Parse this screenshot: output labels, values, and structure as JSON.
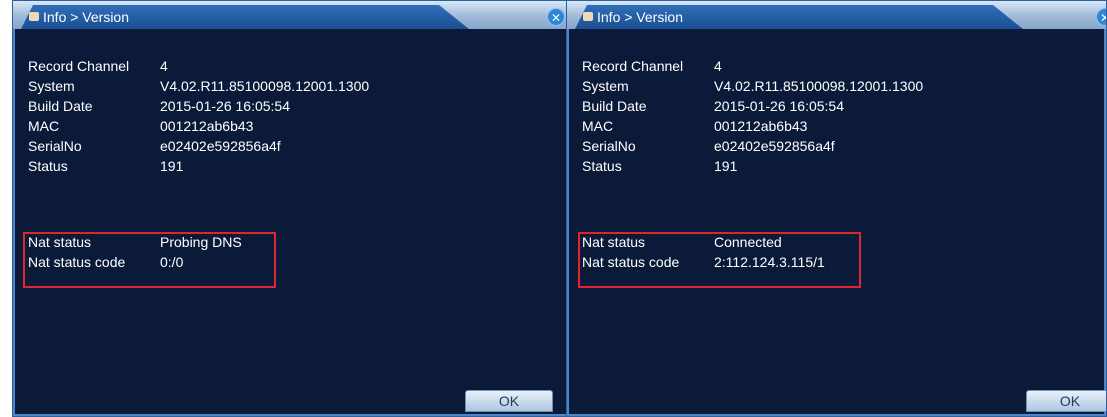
{
  "panels": [
    {
      "breadcrumb": "Info > Version",
      "close_glyph": "✕",
      "rows": [
        {
          "label": "Record Channel",
          "value": "4"
        },
        {
          "label": "System",
          "value": "V4.02.R11.85100098.12001.1300"
        },
        {
          "label": "Build Date",
          "value": "2015-01-26 16:05:54"
        },
        {
          "label": "MAC",
          "value": "001212ab6b43"
        },
        {
          "label": "SerialNo",
          "value": "e02402e592856a4f"
        },
        {
          "label": "Status",
          "value": "191"
        }
      ],
      "nat": [
        {
          "label": "Nat status",
          "value": "Probing DNS"
        },
        {
          "label": "Nat status code",
          "value": "0:/0"
        }
      ],
      "ok_label": "OK"
    },
    {
      "breadcrumb": "Info > Version",
      "close_glyph": "✕",
      "rows": [
        {
          "label": "Record Channel",
          "value": "4"
        },
        {
          "label": "System",
          "value": "V4.02.R11.85100098.12001.1300"
        },
        {
          "label": "Build Date",
          "value": "2015-01-26 16:05:54"
        },
        {
          "label": "MAC",
          "value": "001212ab6b43"
        },
        {
          "label": "SerialNo",
          "value": "e02402e592856a4f"
        },
        {
          "label": "Status",
          "value": "191"
        }
      ],
      "nat": [
        {
          "label": "Nat status",
          "value": "Connected"
        },
        {
          "label": "Nat status code",
          "value": "2:112.124.3.115/1"
        }
      ],
      "ok_label": "OK"
    }
  ],
  "colors": {
    "dialog_bg": "#0c1a3a",
    "highlight_border": "#e0242e",
    "text": "#ffffff",
    "tab": "#1b4f93"
  },
  "icons": {
    "tab": "folder-icon",
    "close": "close-icon"
  }
}
